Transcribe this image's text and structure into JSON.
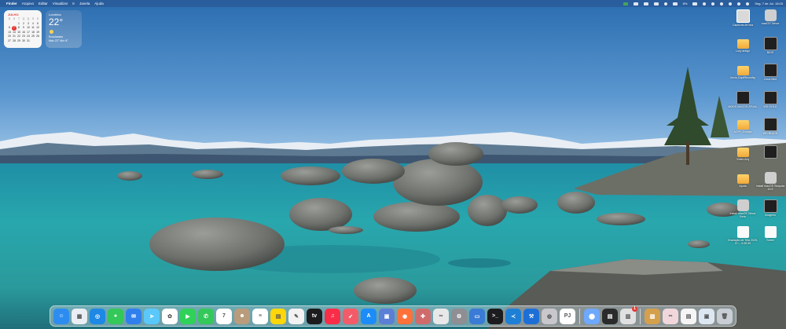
{
  "menubar": {
    "apple_symbol": "",
    "items": [
      "Finder",
      "Arquivo",
      "Editar",
      "Visualizar",
      "Ir",
      "Janela",
      "Ajuda"
    ],
    "clock": "Seg. 7 de Jul.  15:03",
    "battery_text": "8%",
    "status_icons": [
      "status-green-icon",
      "status-box-icon",
      "status-box-icon",
      "status-box-icon",
      "status-box-icon",
      "status-box-icon",
      "battery-icon",
      "network-icon",
      "volume-icon",
      "bluetooth-icon",
      "wifi-icon",
      "search-icon",
      "control-center-icon"
    ]
  },
  "widgets": {
    "calendar": {
      "month": "JULHO",
      "days": [
        "D",
        "S",
        "T",
        "Q",
        "Q",
        "S",
        "S",
        "",
        "",
        "1",
        "2",
        "3",
        "4",
        "5",
        "6",
        "7",
        "8",
        "9",
        "10",
        "11",
        "12",
        "13",
        "14",
        "15",
        "16",
        "17",
        "18",
        "19",
        "20",
        "21",
        "22",
        "23",
        "24",
        "25",
        "26",
        "27",
        "28",
        "29",
        "30",
        "31",
        "",
        ""
      ],
      "today": "7"
    },
    "weather": {
      "city": "Londrina",
      "temp": "22°",
      "condition": "Ensolarado",
      "range": "Máx 22° Mín 8°"
    }
  },
  "desktop_icons": [
    {
      "label": "Capturas de tela",
      "kind": "shot",
      "icon": "screenshot-icon"
    },
    {
      "label": "macOS Tahoe",
      "kind": "disk",
      "icon": "disk-icon"
    },
    {
      "label": "Luzy antigo",
      "kind": "folder",
      "icon": "folder-icon"
    },
    {
      "label": "BIOS",
      "kind": "dark",
      "icon": "dark-app-icon"
    },
    {
      "label": "Inicio-CaptReconfig",
      "kind": "folder",
      "icon": "folder-icon"
    },
    {
      "label": "Linux Mint",
      "kind": "dark",
      "icon": "dark-app-icon"
    },
    {
      "label": "MODS MACOS ATUAL",
      "kind": "dark",
      "icon": "dark-app-icon"
    },
    {
      "label": "WD GOLD",
      "kind": "dark",
      "icon": "dark-app-icon"
    },
    {
      "label": "ACPI - Dumps",
      "kind": "folder",
      "icon": "folder-icon"
    },
    {
      "label": "WD BLACK",
      "kind": "dark",
      "icon": "dark-app-icon"
    },
    {
      "label": "Vídeo Arq",
      "kind": "folder",
      "icon": "folder-icon"
    },
    {
      "label": "",
      "kind": "dark",
      "icon": "dark-app-icon"
    },
    {
      "label": "Ajuda",
      "kind": "folder",
      "icon": "folder-icon"
    },
    {
      "label": "Install macOS Sequoia 15.5",
      "kind": "disk",
      "icon": "installer-icon"
    },
    {
      "label": "Install macOS Tahoe Beta",
      "kind": "disk",
      "icon": "installer-icon"
    },
    {
      "label": "Imagens",
      "kind": "dark",
      "icon": "image-icon"
    },
    {
      "label": "Gravação de Tela 2025-07-...4.08.59",
      "kind": "doc",
      "icon": "video-file-icon"
    },
    {
      "label": "Sobre",
      "kind": "doc",
      "icon": "about-icon"
    }
  ],
  "dock": [
    {
      "name": "finder-icon",
      "color": "#2d8cf0",
      "glyph": "☺"
    },
    {
      "name": "launchpad-icon",
      "color": "#e9eef5",
      "glyph": "▦"
    },
    {
      "name": "safari-icon",
      "color": "#1e88e5",
      "glyph": "◎"
    },
    {
      "name": "messages-icon",
      "color": "#34c759",
      "glyph": "●"
    },
    {
      "name": "mail-icon",
      "color": "#2f80ed",
      "glyph": "✉"
    },
    {
      "name": "maps-icon",
      "color": "#5ac8fa",
      "glyph": "➤"
    },
    {
      "name": "photos-icon",
      "color": "#ffffff",
      "glyph": "✿"
    },
    {
      "name": "facetime-icon",
      "color": "#30d158",
      "glyph": "▶"
    },
    {
      "name": "phone-icon",
      "color": "#34c759",
      "glyph": "✆"
    },
    {
      "name": "calendar-icon",
      "color": "#ffffff",
      "glyph": "7"
    },
    {
      "name": "contacts-icon",
      "color": "#b89c7b",
      "glyph": "☻"
    },
    {
      "name": "reminders-icon",
      "color": "#ffffff",
      "glyph": "≡"
    },
    {
      "name": "notes-icon",
      "color": "#ffd60a",
      "glyph": "▤"
    },
    {
      "name": "freeform-icon",
      "color": "#f2f2f2",
      "glyph": "✎"
    },
    {
      "name": "tv-icon",
      "color": "#1c1c1e",
      "glyph": "tv"
    },
    {
      "name": "music-icon",
      "color": "#fa2d48",
      "glyph": "♫"
    },
    {
      "name": "rocket-icon",
      "color": "#f45b69",
      "glyph": "➶"
    },
    {
      "name": "app-store-icon",
      "color": "#1c8cf9",
      "glyph": "A"
    },
    {
      "name": "preview-icon",
      "color": "#5b7fd6",
      "glyph": "▣"
    },
    {
      "name": "firefox-icon",
      "color": "#ff7139",
      "glyph": "◉"
    },
    {
      "name": "tool-icon",
      "color": "#d16b6b",
      "glyph": "✚"
    },
    {
      "name": "ai-icon",
      "color": "#e8e8e8",
      "glyph": "∞"
    },
    {
      "name": "settings-icon",
      "color": "#8e8e93",
      "glyph": "⚙"
    },
    {
      "name": "screen-sharing-icon",
      "color": "#3a7bd5",
      "glyph": "▭"
    },
    {
      "name": "terminal-icon",
      "color": "#1c1c1e",
      "glyph": ">_"
    },
    {
      "name": "vscode-icon",
      "color": "#1e7fd6",
      "glyph": "≺"
    },
    {
      "name": "xcode-icon",
      "color": "#1d6fd6",
      "glyph": "⚒"
    },
    {
      "name": "disk-utility-icon",
      "color": "#c7c7cc",
      "glyph": "◍"
    },
    {
      "name": "pdf-icon",
      "color": "#ffffff",
      "glyph": "PJ"
    },
    {
      "name": "separator"
    },
    {
      "name": "migration-icon",
      "color": "#6ea8ff",
      "glyph": "⬤"
    },
    {
      "name": "console-icon",
      "color": "#2b2b2b",
      "glyph": "▤"
    },
    {
      "name": "printer-icon",
      "color": "#e0e0e0",
      "glyph": "▥",
      "badge": true
    },
    {
      "name": "separator"
    },
    {
      "name": "archive-icon",
      "color": "#d4a04c",
      "glyph": "▧"
    },
    {
      "name": "ai-folder-icon",
      "color": "#f1d7dc",
      "glyph": "∞"
    },
    {
      "name": "doc-stack-icon",
      "color": "#f5f5f5",
      "glyph": "▤"
    },
    {
      "name": "screenshot-stack-icon",
      "color": "#dce7f2",
      "glyph": "▣"
    },
    {
      "name": "trash-icon",
      "color": "#c9ced4",
      "glyph": "🗑"
    }
  ]
}
